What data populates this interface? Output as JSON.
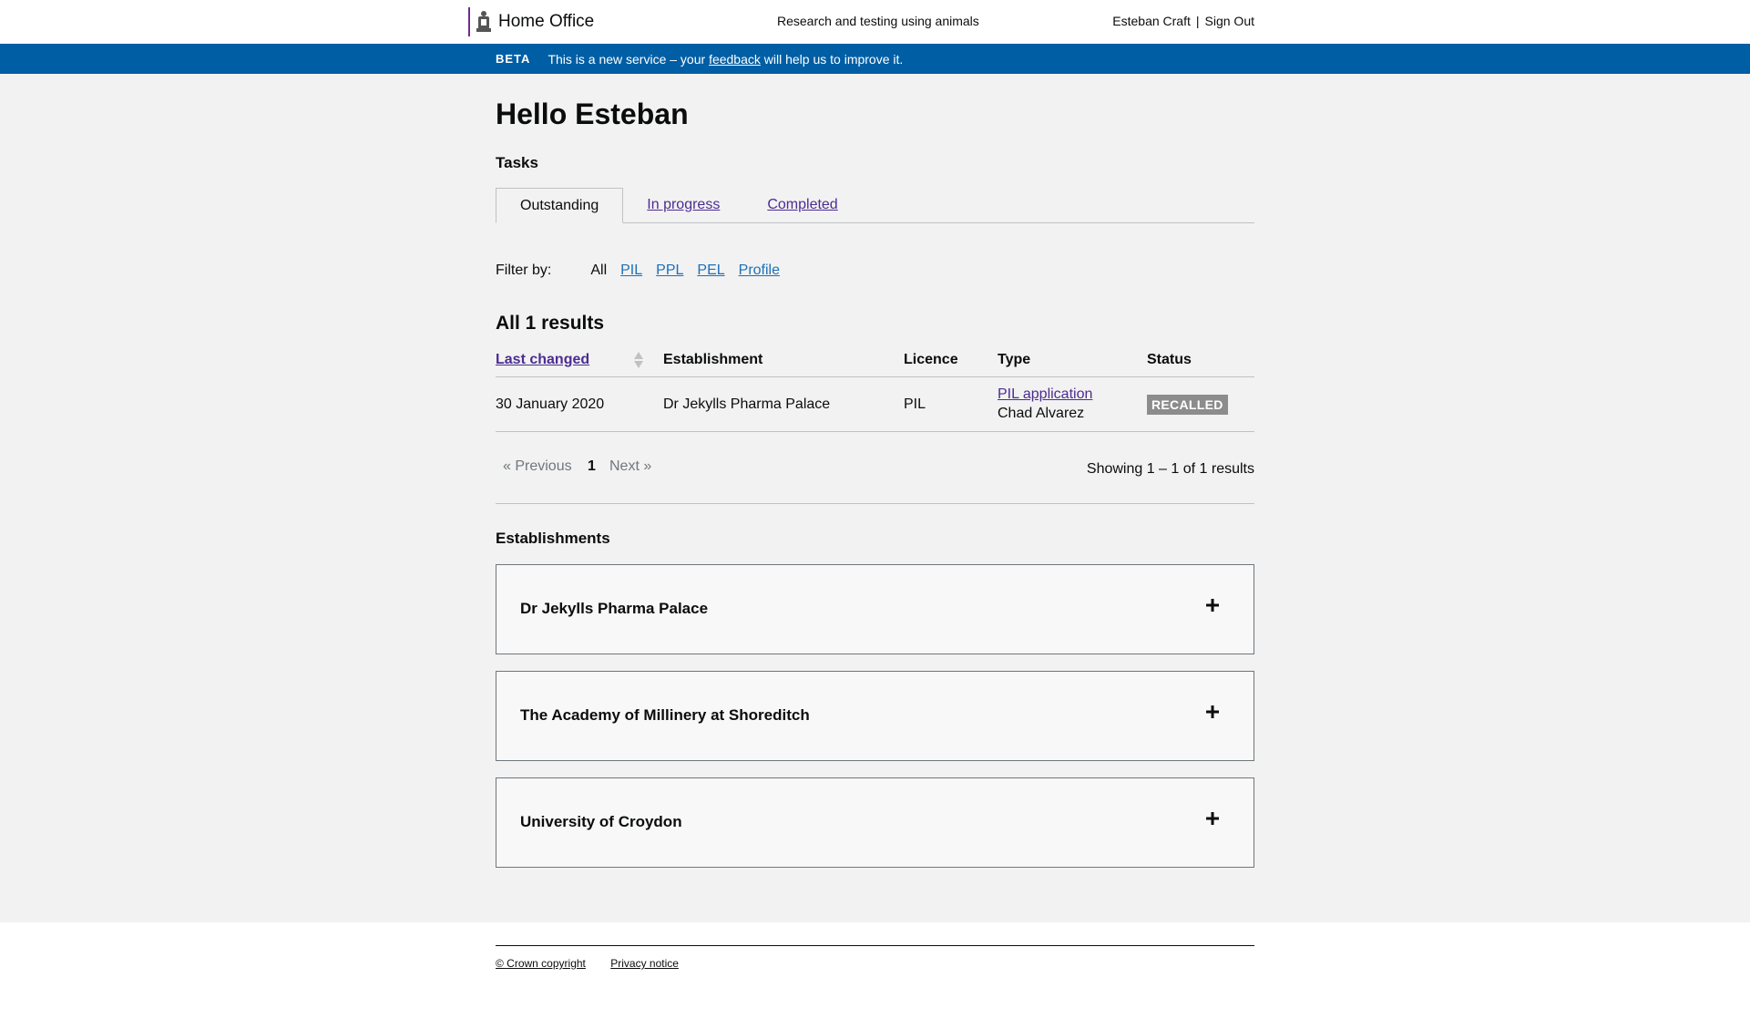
{
  "header": {
    "brand": "Home Office",
    "service_name": "Research and testing using animals",
    "user_name": "Esteban Craft",
    "separator": "|",
    "sign_out": "Sign Out"
  },
  "beta": {
    "tag": "BETA",
    "text_before": "This is a new service – your ",
    "link": "feedback",
    "text_after": " will help us to improve it."
  },
  "main": {
    "greeting": "Hello Esteban",
    "tasks_title": "Tasks",
    "tabs": [
      {
        "label": "Outstanding",
        "active": true
      },
      {
        "label": "In progress",
        "active": false
      },
      {
        "label": "Completed",
        "active": false
      }
    ],
    "filter": {
      "label": "Filter by:",
      "items": [
        "All",
        "PIL",
        "PPL",
        "PEL",
        "Profile"
      ],
      "selected": "All"
    },
    "results_title": "All 1 results",
    "table": {
      "headers": [
        "Last changed",
        "Establishment",
        "Licence",
        "Type",
        "Status"
      ],
      "rows": [
        {
          "last_changed": "30 January 2020",
          "establishment": "Dr Jekylls Pharma Palace",
          "licence": "PIL",
          "type_link": "PIL application",
          "type_sub": "Chad Alvarez",
          "status": "RECALLED"
        }
      ]
    },
    "pager": {
      "prev": "« Previous",
      "page": "1",
      "next": "Next »",
      "showing": "Showing 1 – 1 of 1 results"
    },
    "establishments_title": "Establishments",
    "establishments": [
      "Dr Jekylls Pharma Palace",
      "The Academy of Millinery at Shoreditch",
      "University of Croydon"
    ]
  },
  "footer": {
    "copyright": "© Crown copyright",
    "privacy": "Privacy notice"
  },
  "colors": {
    "beta_bar": "#005ea5",
    "link": "#4c2c92",
    "filter_link": "#1d70b8",
    "status_badge": "#8c8c8c",
    "page_bg": "#f2f2f2"
  }
}
